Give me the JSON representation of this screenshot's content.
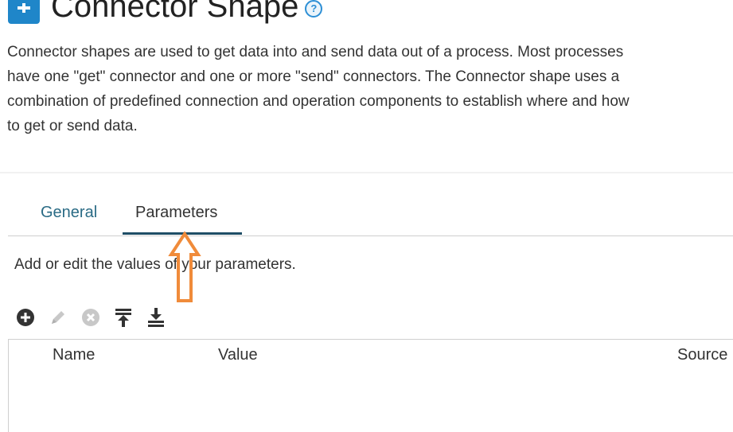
{
  "header": {
    "title": "Connector Shape",
    "shape_icon": "connector-icon",
    "help_icon": "?"
  },
  "description": [
    "Connector shapes are used to get data into and send data out of a process. Most processes",
    "have one \"get\" connector and one or more \"send\" connectors. The Connector shape uses a",
    "combination of predefined connection and operation components to establish where and how",
    "to get or send data."
  ],
  "tabs": [
    {
      "label": "General",
      "active": false
    },
    {
      "label": "Parameters",
      "active": true
    }
  ],
  "parameters": {
    "instructions": "Add or edit the values of your parameters.",
    "toolbar": [
      "add-icon",
      "edit-icon",
      "delete-icon",
      "move-up-icon",
      "move-down-icon"
    ],
    "columns": [
      "Name",
      "Value",
      "Source"
    ],
    "rows": []
  },
  "colors": {
    "accent": "#1f86c9",
    "tab_active_underline": "#1f4e66",
    "tab_inactive": "#2a6b85",
    "annotation": "#f08b3a"
  }
}
